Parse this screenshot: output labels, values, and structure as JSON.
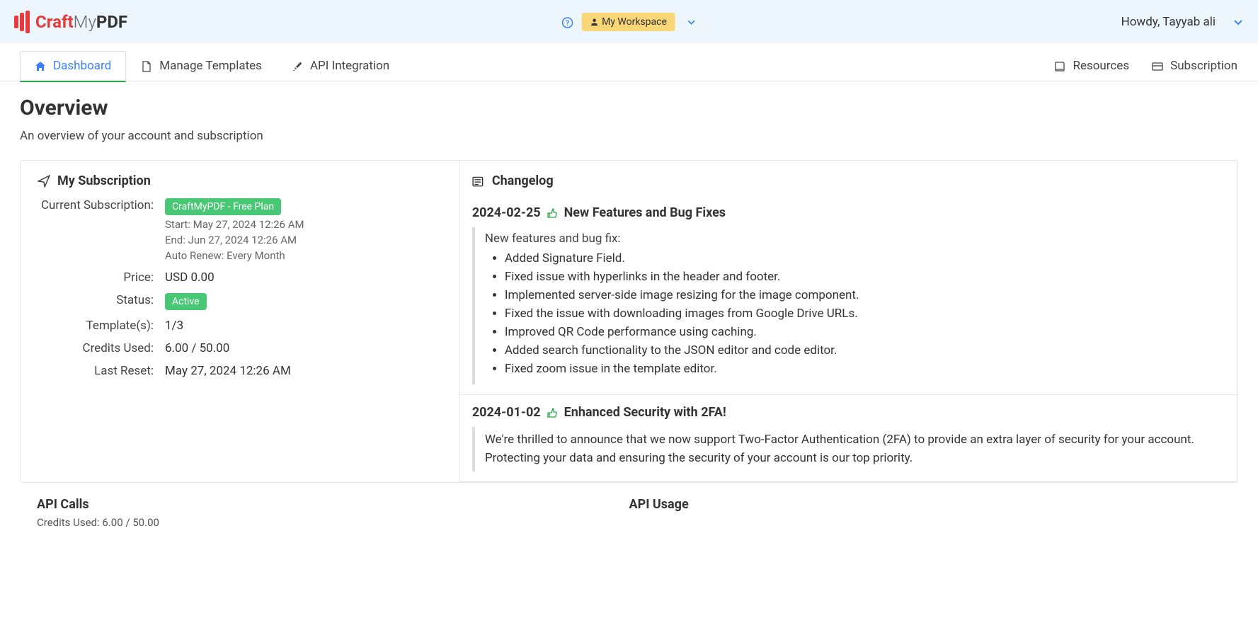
{
  "logo": {
    "craft": "Craft",
    "my": "My",
    "pdf": "PDF"
  },
  "topbar": {
    "workspace_label": "My Workspace",
    "greeting": "Howdy, Tayyab ali"
  },
  "tabs": {
    "dashboard": "Dashboard",
    "templates": "Manage Templates",
    "api": "API Integration",
    "resources": "Resources",
    "subscription": "Subscription"
  },
  "page": {
    "title": "Overview",
    "subtitle": "An overview of your account and subscription"
  },
  "subscription": {
    "title": "My Subscription",
    "labels": {
      "current": "Current Subscription:",
      "price": "Price:",
      "status": "Status:",
      "templates": "Template(s):",
      "credits": "Credits Used:",
      "reset": "Last Reset:"
    },
    "plan": "CraftMyPDF - Free Plan",
    "start": "Start: May 27, 2024 12:26 AM",
    "end": "End: Jun 27, 2024 12:26 AM",
    "renew": "Auto Renew: Every Month",
    "price": "USD 0.00",
    "status": "Active",
    "templates": "1/3",
    "credits": "6.00 / 50.00",
    "reset": "May 27, 2024 12:26 AM"
  },
  "changelog": {
    "title": "Changelog",
    "entries": [
      {
        "date": "2024-02-25",
        "headline": "New Features and Bug Fixes",
        "intro": "New features and bug fix:",
        "items": [
          "Added Signature Field.",
          "Fixed issue with hyperlinks in the header and footer.",
          "Implemented server-side image resizing for the image component.",
          "Fixed the issue with downloading images from Google Drive URLs.",
          "Improved QR Code performance using caching.",
          "Added search functionality to the JSON editor and code editor.",
          "Fixed zoom issue in the template editor."
        ]
      },
      {
        "date": "2024-01-02",
        "headline": "Enhanced Security with 2FA!",
        "para": "We're thrilled to announce that we now support Two-Factor Authentication (2FA) to provide an extra layer of security for your account. Protecting your data and ensuring the security of your account is our top priority."
      }
    ]
  },
  "bottom": {
    "api_calls": "API Calls",
    "api_usage": "API Usage",
    "credits_used": "Credits Used: 6.00 / 50.00"
  }
}
